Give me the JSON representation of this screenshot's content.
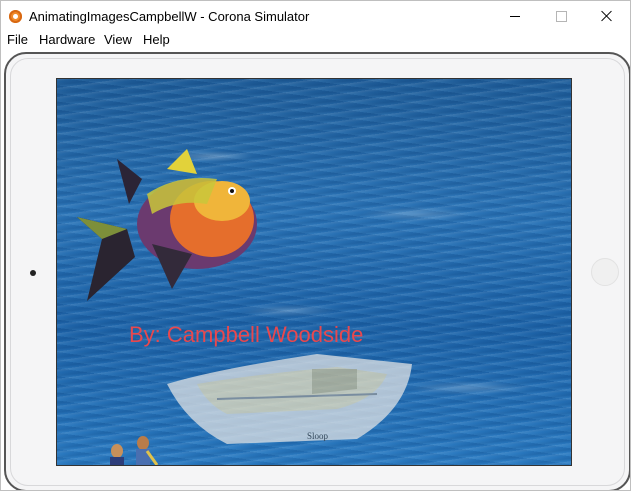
{
  "window": {
    "title": "AnimatingImagesCampbellW - Corona Simulator",
    "icon": "corona-simulator-icon"
  },
  "menu": {
    "items": [
      "File",
      "Hardware",
      "View",
      "Help"
    ]
  },
  "app": {
    "credit_text": "By: Campbell Woodside",
    "boat_name": "Sloop",
    "colors": {
      "credit": "#e8484e",
      "water": "#2a73b6"
    }
  }
}
